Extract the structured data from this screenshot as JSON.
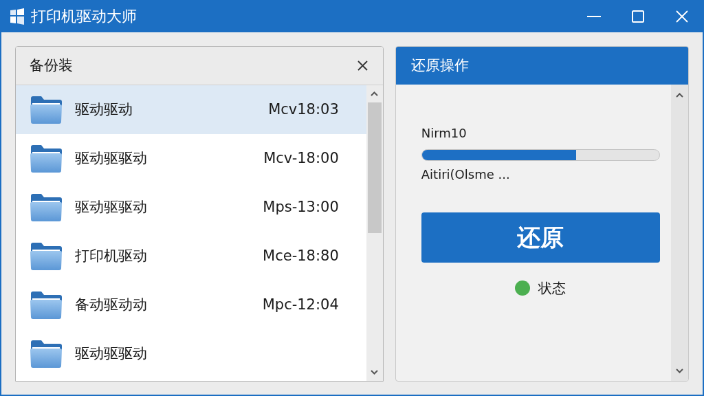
{
  "window": {
    "title": "打印机驱动大师"
  },
  "backup_panel": {
    "title": "备份装",
    "items": [
      {
        "name": "驱动驱动",
        "time": "Mcv18:03",
        "selected": true
      },
      {
        "name": "驱动驱驱动",
        "time": "Mcv-18:00",
        "selected": false
      },
      {
        "name": "驱动驱驱动",
        "time": "Mps-13:00",
        "selected": false
      },
      {
        "name": "打印机驱动",
        "time": "Mce-18:80",
        "selected": false
      },
      {
        "name": "备动驱动动",
        "time": "Mpc-12:04",
        "selected": false
      },
      {
        "name": "驱动驱驱动",
        "selected": false
      }
    ]
  },
  "restore_panel": {
    "title": "还原操作",
    "progress": {
      "label": "Nirm10",
      "level": 0.65,
      "caption": "Aitiri(Olsme ..."
    },
    "button": "还原",
    "status": {
      "label": "状态",
      "color": "#4caf50"
    }
  }
}
